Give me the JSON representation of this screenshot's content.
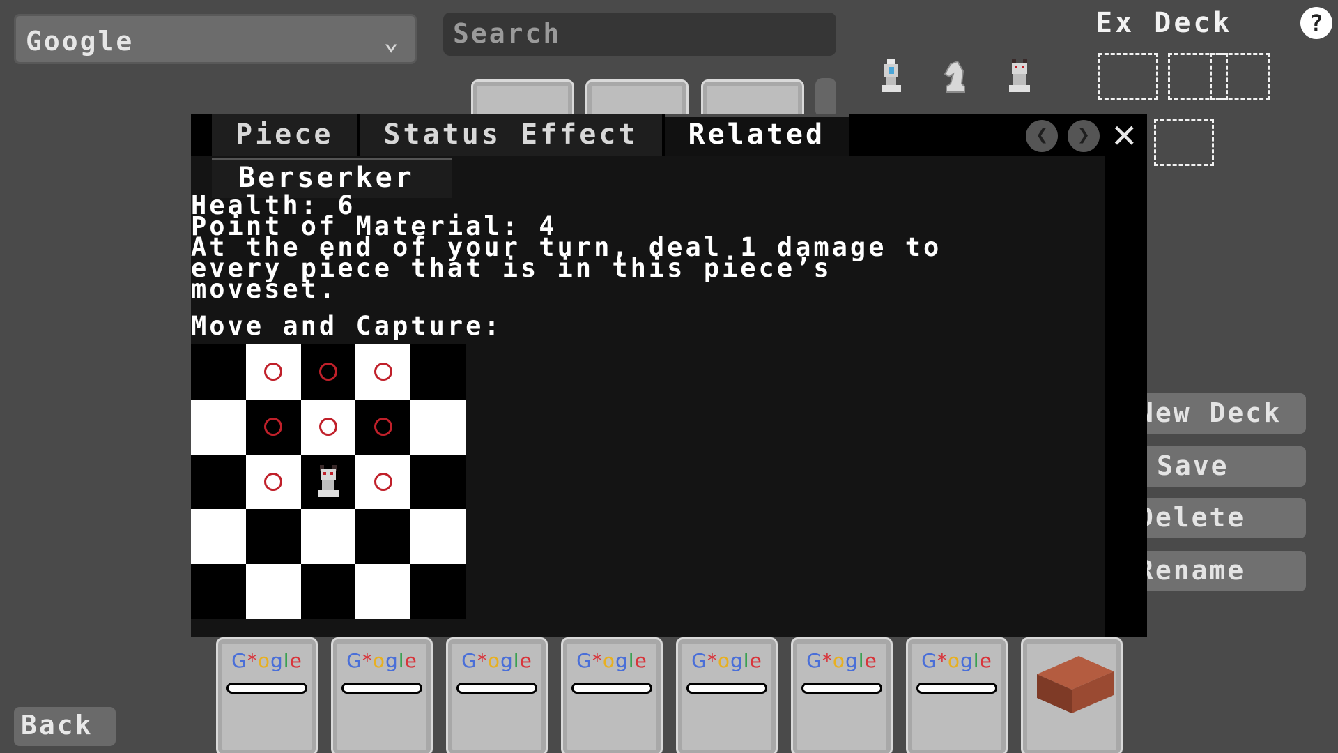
{
  "deck_select": {
    "value": "Google"
  },
  "search": {
    "placeholder": "Search"
  },
  "ex_deck": {
    "title": "Ex Deck"
  },
  "help": {
    "label": "?"
  },
  "side_buttons": {
    "new_deck": "New Deck",
    "save": "Save",
    "delete": "Delete",
    "rename": "Rename"
  },
  "back": {
    "label": "Back"
  },
  "modal": {
    "tabs": [
      "Piece",
      "Status Effect",
      "Related"
    ],
    "active_tab": "Related",
    "nav_prev": "❮",
    "nav_next": "❯",
    "close": "✕",
    "subtab": "Berserker",
    "health_line": "Health: 6",
    "material_line": "Point of Material: 4",
    "desc_lines": [
      "At the end of your turn, deal 1 damage to",
      "every piece that is in this piece’s",
      "moveset."
    ],
    "move_capture_label": "Move and Capture:",
    "board": {
      "size": 5,
      "piece_square": [
        2,
        2
      ],
      "move_squares": [
        [
          0,
          1
        ],
        [
          0,
          2
        ],
        [
          0,
          3
        ],
        [
          1,
          1
        ],
        [
          1,
          2
        ],
        [
          1,
          3
        ],
        [
          2,
          1
        ],
        [
          2,
          3
        ]
      ]
    }
  },
  "bottom_cards": [
    {
      "type": "google",
      "logo_letters": [
        "G",
        "*",
        "o",
        "g",
        "l",
        "e"
      ]
    },
    {
      "type": "google",
      "logo_letters": [
        "G",
        "*",
        "o",
        "g",
        "l",
        "e"
      ]
    },
    {
      "type": "google",
      "logo_letters": [
        "G",
        "*",
        "o",
        "g",
        "l",
        "e"
      ]
    },
    {
      "type": "google",
      "logo_letters": [
        "G",
        "*",
        "o",
        "g",
        "l",
        "e"
      ]
    },
    {
      "type": "google",
      "logo_letters": [
        "G",
        "*",
        "o",
        "g",
        "l",
        "e"
      ]
    },
    {
      "type": "google",
      "logo_letters": [
        "G",
        "*",
        "o",
        "g",
        "l",
        "e"
      ]
    },
    {
      "type": "google",
      "logo_letters": [
        "G",
        "*",
        "o",
        "g",
        "l",
        "e"
      ]
    },
    {
      "type": "brick"
    }
  ],
  "colors": {
    "logo": [
      "#4a6fd8",
      "#d8343a",
      "#e8b020",
      "#4a6fd8",
      "#2e9e48",
      "#d8343a"
    ],
    "move_dot": "#c0202a",
    "brick": "#9a4a32"
  }
}
